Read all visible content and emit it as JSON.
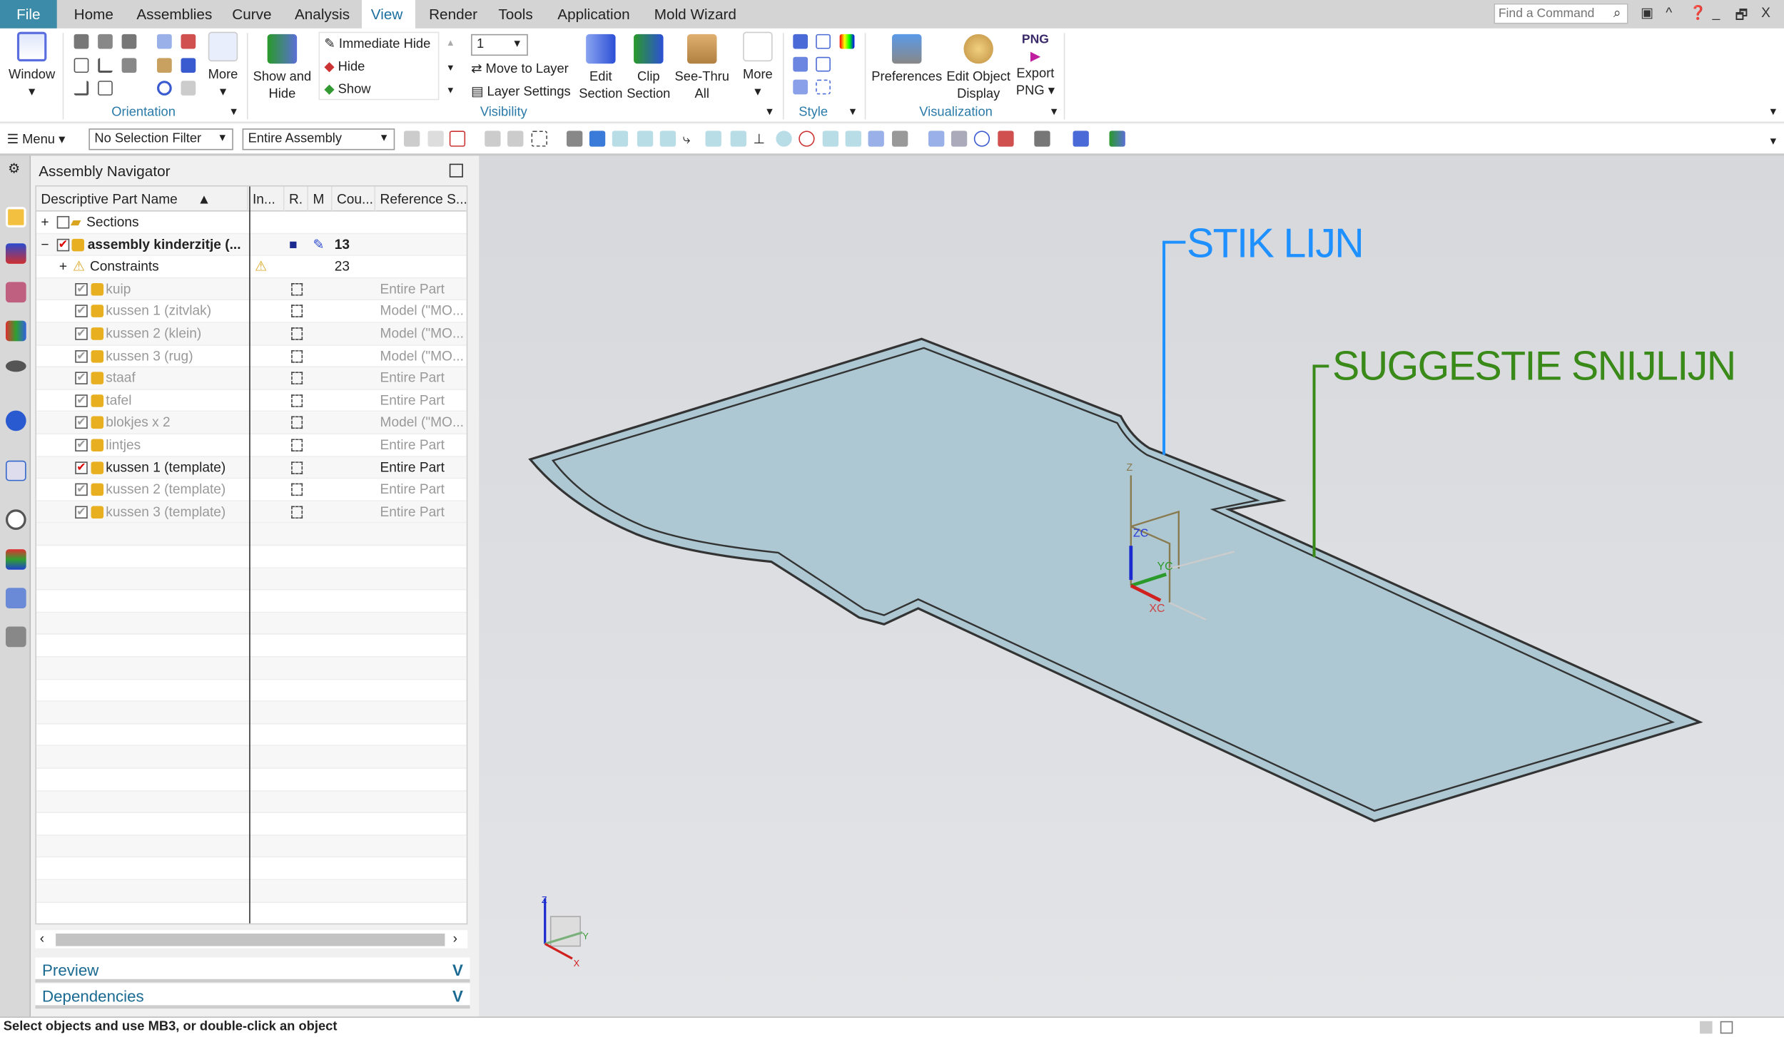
{
  "tabs": {
    "file": "File",
    "items": [
      "Home",
      "Assemblies",
      "Curve",
      "Analysis",
      "View",
      "Render",
      "Tools",
      "Application",
      "Mold Wizard"
    ],
    "active": "View"
  },
  "search": {
    "placeholder": "Find a Command"
  },
  "ribbon": {
    "window": "Window",
    "orientation_more": "More",
    "show_and_hide": "Show and Hide",
    "immediate_hide": "Immediate Hide",
    "hide": "Hide",
    "show": "Show",
    "layer_value": "1",
    "move_to_layer": "Move to Layer",
    "layer_settings": "Layer Settings",
    "edit_section": "Edit Section",
    "clip_section": "Clip Section",
    "see_thru_all": "See-Thru All",
    "visibility_more": "More",
    "preferences": "Preferences",
    "edit_object_display": "Edit Object Display",
    "export_png": "Export PNG",
    "png_badge": "PNG",
    "groups": {
      "orientation": "Orientation",
      "visibility": "Visibility",
      "style": "Style",
      "visualization": "Visualization"
    }
  },
  "toolbar": {
    "menu": "Menu",
    "selection_filter": "No Selection Filter",
    "scope": "Entire Assembly"
  },
  "navigator": {
    "title": "Assembly Navigator",
    "columns": [
      "Descriptive Part Name",
      "In...",
      "R.",
      "M",
      "Cou...",
      "Reference S..."
    ],
    "sections": "Sections",
    "assembly": {
      "name": "assembly kinderzitje (...",
      "count": "13"
    },
    "constraints": {
      "name": "Constraints",
      "count": "23"
    },
    "parts": [
      {
        "name": "kuip",
        "ref": "Entire Part",
        "active": false
      },
      {
        "name": "kussen 1 (zitvlak)",
        "ref": "Model (\"MO...",
        "active": false
      },
      {
        "name": "kussen 2 (klein)",
        "ref": "Model (\"MO...",
        "active": false
      },
      {
        "name": "kussen 3 (rug)",
        "ref": "Model (\"MO...",
        "active": false
      },
      {
        "name": "staaf",
        "ref": "Entire Part",
        "active": false
      },
      {
        "name": "tafel",
        "ref": "Entire Part",
        "active": false
      },
      {
        "name": "blokjes x 2",
        "ref": "Model (\"MO...",
        "active": false
      },
      {
        "name": "lintjes",
        "ref": "Entire Part",
        "active": false
      },
      {
        "name": "kussen 1 (template)",
        "ref": "Entire Part",
        "active": true
      },
      {
        "name": "kussen 2 (template)",
        "ref": "Entire Part",
        "active": false
      },
      {
        "name": "kussen 3 (template)",
        "ref": "Entire Part",
        "active": false
      }
    ],
    "panels": [
      "Preview",
      "Dependencies"
    ]
  },
  "viewport": {
    "annotations": [
      {
        "text": "STIK LIJN",
        "color": "#1e90ff"
      },
      {
        "text": "SUGGESTIE SNIJLIJN",
        "color": "#3a8a1a"
      }
    ],
    "csys_labels": {
      "z": "Z",
      "zc": "ZC",
      "yc": "YC",
      "xc": "XC",
      "y": "Y",
      "x": "X"
    },
    "part_fill": "#adc8d2"
  },
  "status": "Select objects and use MB3, or double-click an object"
}
